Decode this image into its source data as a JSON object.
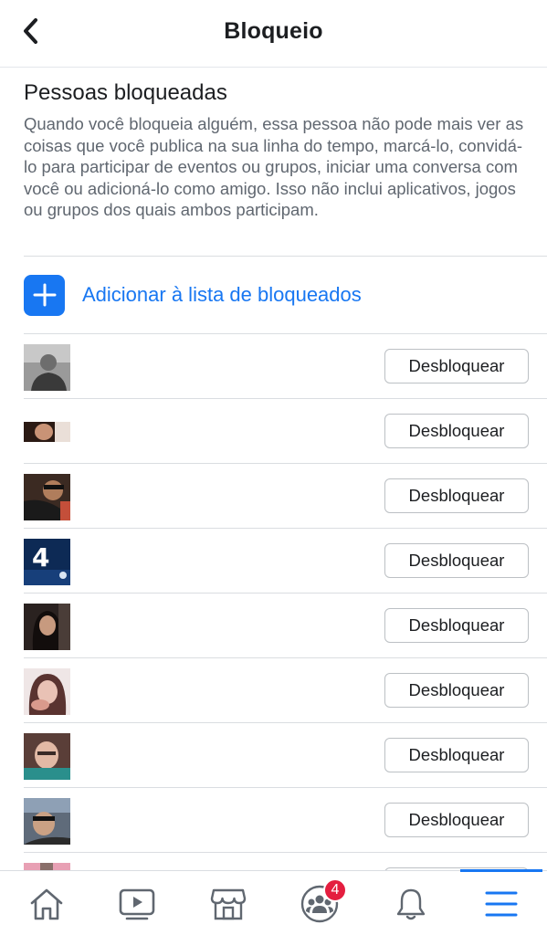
{
  "header": {
    "title": "Bloqueio"
  },
  "blocked": {
    "section_title": "Pessoas bloqueadas",
    "description": "Quando você bloqueia alguém, essa pessoa não pode mais ver as coisas que você publica na sua linha do tempo, marcá-lo, convidá-lo para participar de eventos ou grupos, iniciar uma conversa com você ou adicioná-lo como amigo. Isso não inclui aplicativos, jogos ou grupos dos quais ambos participam.",
    "add_label": "Adicionar à lista de bloqueados",
    "unblock_label": "Desbloquear",
    "people": [
      {
        "avatar": "avatar-1"
      },
      {
        "avatar": "avatar-2"
      },
      {
        "avatar": "avatar-3"
      },
      {
        "avatar": "avatar-4",
        "avatar_text": "4"
      },
      {
        "avatar": "avatar-5"
      },
      {
        "avatar": "avatar-6"
      },
      {
        "avatar": "avatar-7"
      },
      {
        "avatar": "avatar-8"
      }
    ]
  },
  "tabbar": {
    "items": [
      {
        "icon": "home-icon"
      },
      {
        "icon": "video-icon"
      },
      {
        "icon": "marketplace-icon"
      },
      {
        "icon": "groups-icon",
        "badge": "4"
      },
      {
        "icon": "bell-icon"
      },
      {
        "icon": "menu-icon"
      }
    ]
  },
  "colors": {
    "accent": "#1877f2",
    "badge": "#e41e3f",
    "text": "#1c1e21",
    "secondary": "#606770"
  }
}
